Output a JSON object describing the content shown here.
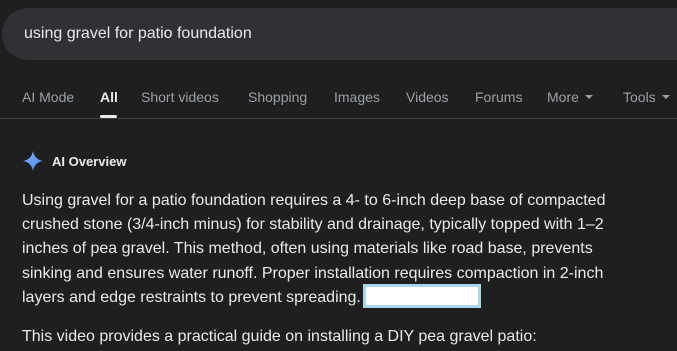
{
  "search": {
    "query": "using gravel for patio foundation"
  },
  "tabs": [
    {
      "label": "AI Mode"
    },
    {
      "label": "All"
    },
    {
      "label": "Short videos"
    },
    {
      "label": "Shopping"
    },
    {
      "label": "Images"
    },
    {
      "label": "Videos"
    },
    {
      "label": "Forums"
    },
    {
      "label": "More"
    },
    {
      "label": "Tools"
    }
  ],
  "ai_overview": {
    "title": "AI Overview",
    "icon": "sparkle-icon",
    "lines": [
      "Using gravel for a patio foundation requires a 4- to 6-inch deep base of compacted",
      "crushed stone (3/4-inch minus) for stability and drainage, typically topped with 1–2",
      "inches of pea gravel. This method, often using materials like road base, prevents",
      "sinking and ensures water runoff. Proper installation requires compaction in 2-inch",
      "layers and edge restraints to prevent spreading."
    ],
    "video_intro": "This video provides a practical guide on installing a DIY pea gravel patio:"
  },
  "colors": {
    "background": "#1f1f1f",
    "search_bar": "#303134",
    "text_primary": "#e8eaed",
    "text_secondary": "#9aa0a6",
    "highlight_border": "#a8d8e8",
    "sparkle_blue": "#4285f4"
  }
}
